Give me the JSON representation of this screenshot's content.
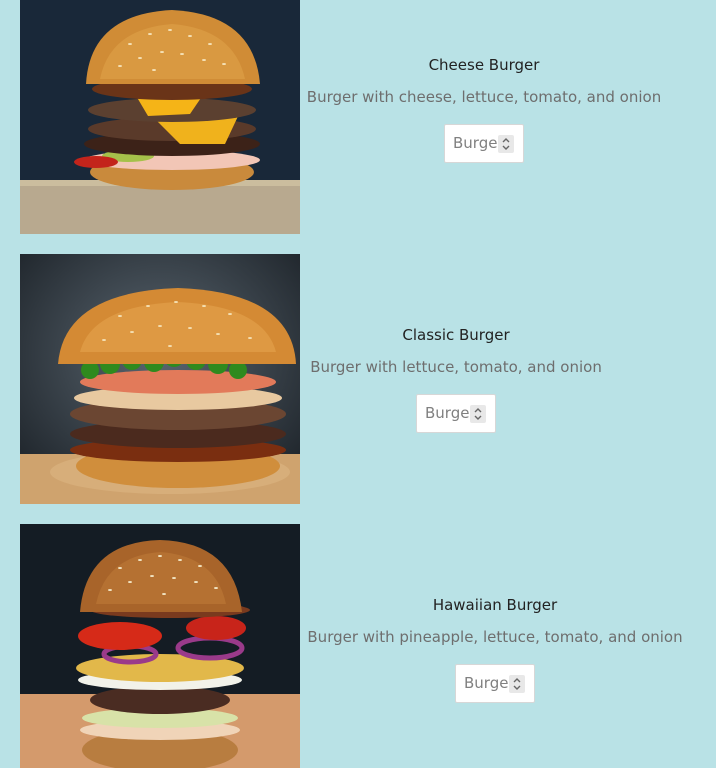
{
  "colors": {
    "page_background": "#b9e2e6"
  },
  "menu": {
    "items": [
      {
        "title": "Cheese Burger",
        "description": "Burger with cheese, lettuce, tomato, and onion",
        "quantity_placeholder": "Burger",
        "image_icon": "cheese-burger-photo"
      },
      {
        "title": "Classic Burger",
        "description": "Burger with lettuce, tomato, and onion",
        "quantity_placeholder": "Burger",
        "image_icon": "classic-burger-photo"
      },
      {
        "title": "Hawaiian Burger",
        "description": "Burger with pineapple, lettuce, tomato, and onion",
        "quantity_placeholder": "Burger",
        "image_icon": "hawaiian-burger-photo"
      }
    ]
  }
}
